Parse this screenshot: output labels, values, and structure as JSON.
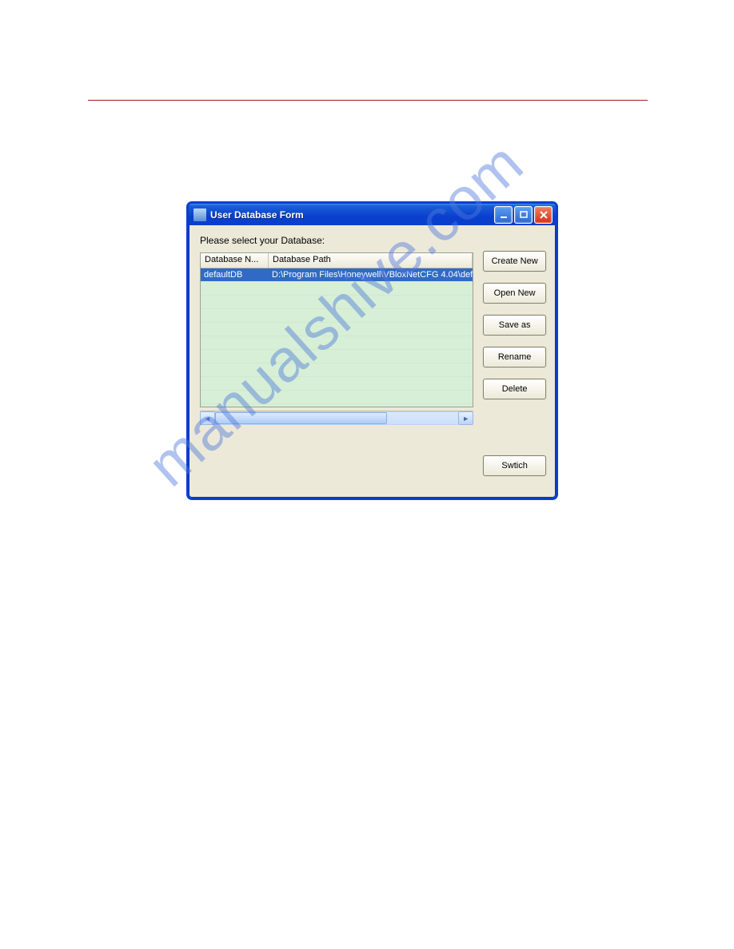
{
  "watermark": "manualshive.com",
  "window": {
    "title": "User Database  Form",
    "prompt": "Please select your Database:",
    "columns": {
      "name": "Database N...",
      "path": "Database Path"
    },
    "rows": [
      {
        "name": "defaultDB",
        "path": "D:\\Program Files\\Honeywell\\VBloxNetCFG 4.04\\def"
      }
    ],
    "buttons": {
      "create_new": "Create New",
      "open_new": "Open New",
      "save_as": "Save as",
      "rename": "Rename",
      "delete": "Delete",
      "switch": "Swtich"
    }
  }
}
